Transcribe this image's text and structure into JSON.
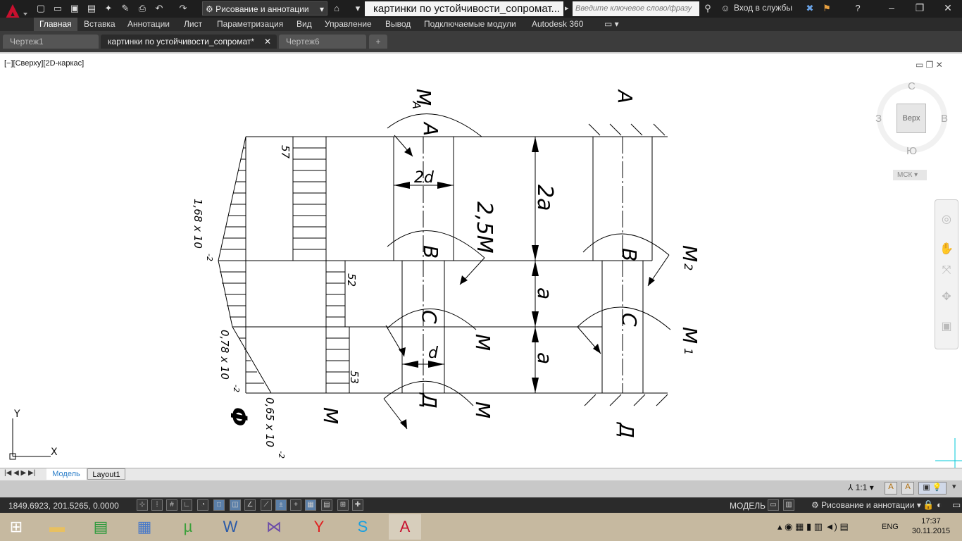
{
  "title_bar": {
    "workspace": "Рисование и аннотации",
    "document_title": "картинки по устойчивости_сопромат...",
    "search_placeholder": "Введите ключевое слово/фразу",
    "login": "Вход в службы"
  },
  "ribbon_tabs": [
    "Главная",
    "Вставка",
    "Аннотации",
    "Лист",
    "Параметризация",
    "Вид",
    "Управление",
    "Вывод",
    "Подключаемые модули",
    "Autodesk 360"
  ],
  "doc_tabs": [
    "Чертеж1",
    "картинки по устойчивости_сопромат*",
    "Чертеж6"
  ],
  "viewport_label": "[−][Сверху][2D-каркас]",
  "viewcube": {
    "top": "Верх",
    "n": "С",
    "s": "Ю",
    "w": "З",
    "e": "В",
    "wcs": "МСК"
  },
  "drawing": {
    "texts": {
      "ma": "M",
      "ma_sub": "A",
      "a_top": "A",
      "a_left": "A",
      "d2": "2d",
      "m25": "2,5M",
      "a2": "2a",
      "v_left": "B",
      "v_right": "B",
      "m2": "M",
      "m2_sub": "2",
      "a_mid": "a",
      "a_bot": "a",
      "c_left": "C",
      "c_right": "C",
      "m_mid": "M",
      "m1": "M",
      "m1_sub": "1",
      "d": "d",
      "d_left": "Д",
      "d_right": "Д",
      "m_bot": "M",
      "m_low": "M",
      "phi": "Φ",
      "n57": "57",
      "n52": "52",
      "n53": "53",
      "v168": "1,68 x 10",
      "v168_exp": "-2",
      "v078": "0,78 x 10",
      "v078_exp": "-2",
      "v065": "0,65 x 10",
      "v065_exp": "-2"
    }
  },
  "layout_tabs": [
    "Модель",
    "Layout1"
  ],
  "status": {
    "coords": "1849.6923, 201.5265, 0.0000",
    "model": "МОДЕЛЬ",
    "scale": "1:1",
    "workspace": "Рисование и аннотации"
  },
  "taskbar": {
    "lang": "ENG",
    "time": "17:37",
    "date": "30.11.2015"
  }
}
